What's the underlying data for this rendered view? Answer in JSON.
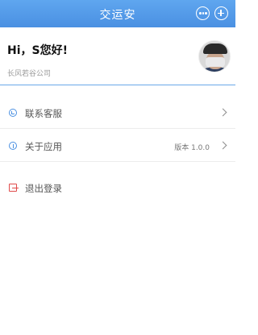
{
  "header": {
    "title": "交运安",
    "more_icon": "ellipsis-circle-icon",
    "add_icon": "plus-circle-icon"
  },
  "user": {
    "greeting": "Hi，S您好!",
    "company": "长风若谷公司"
  },
  "menu": {
    "items": [
      {
        "label": "联系客服",
        "icon": "customer-service-icon"
      },
      {
        "label": "关于应用",
        "icon": "info-icon",
        "value": "版本 1.0.0"
      },
      {
        "label": "退出登录",
        "icon": "logout-icon"
      }
    ]
  },
  "colors": {
    "header": "#4a90e2",
    "accent": "#4a90e2",
    "logout": "#e04b4b"
  }
}
